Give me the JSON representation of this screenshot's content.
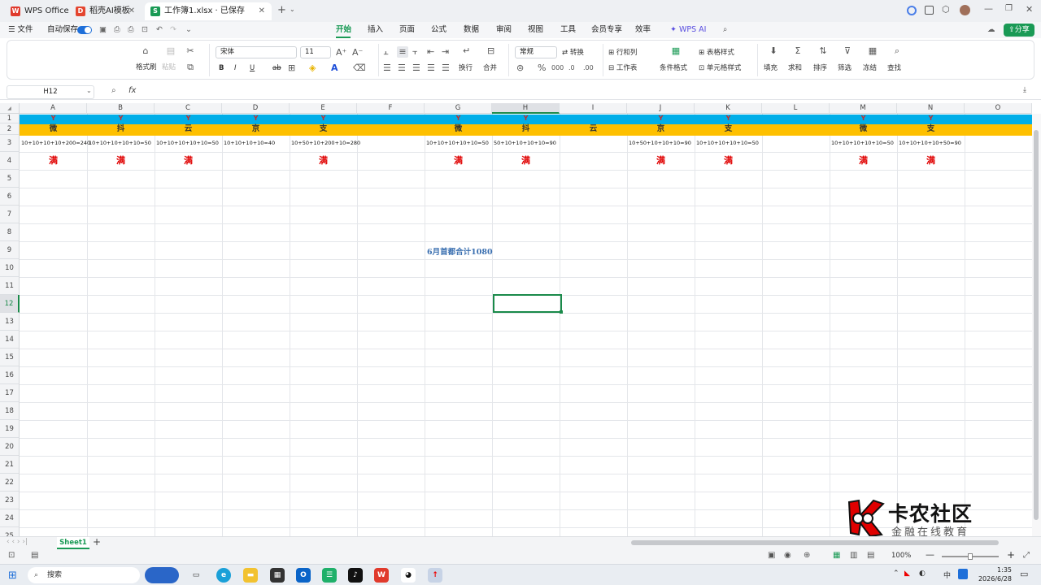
{
  "tabs": [
    {
      "label": "WPS Office",
      "icon": "W"
    },
    {
      "label": "稻壳AI模板",
      "icon": "D"
    },
    {
      "label": "工作簿1.xlsx · 已保存",
      "icon": "S"
    }
  ],
  "menu": {
    "file": "文件",
    "autosave": "自动保存",
    "items": [
      "开始",
      "插入",
      "页面",
      "公式",
      "数据",
      "审阅",
      "视图",
      "工具",
      "会员专享",
      "效率",
      "WPS AI"
    ],
    "share": "分享"
  },
  "ribbon": {
    "format_painter": "格式刷",
    "paste": "粘贴",
    "font": "宋体",
    "size": "11",
    "bold": "B",
    "italic": "I",
    "underline": "U",
    "strike": "ab",
    "wrap": "换行",
    "merge": "合并",
    "numformat": "常规",
    "convert": "转换",
    "rowcol": "行和列",
    "worksheet": "工作表",
    "cond": "条件格式",
    "tablestyle": "表格样式",
    "cellstyle": "单元格样式",
    "fill": "填充",
    "sum": "求和",
    "sort": "排序",
    "filter": "筛选",
    "freeze": "冻结",
    "find": "查找"
  },
  "formula": {
    "cellref": "H12",
    "fx": "fx",
    "value": ""
  },
  "columns": [
    "A",
    "B",
    "C",
    "D",
    "E",
    "F",
    "G",
    "H",
    "I",
    "J",
    "K",
    "L",
    "M",
    "N",
    "O"
  ],
  "rows": [
    "1",
    "2",
    "3",
    "4",
    "5",
    "6",
    "7",
    "8",
    "9",
    "10",
    "11",
    "12",
    "13",
    "14",
    "15",
    "16",
    "17",
    "18",
    "19",
    "20",
    "21",
    "22",
    "23",
    "24",
    "25"
  ],
  "row1": {
    "A": "Y",
    "B": "Y",
    "C": "Y",
    "D": "Y",
    "E": "Y",
    "G": "Y",
    "H": "Y",
    "I": "",
    "J": "Y",
    "K": "Y",
    "M": "Y",
    "N": "Y"
  },
  "row2": {
    "A": "微",
    "B": "抖",
    "C": "云",
    "D": "京",
    "E": "支",
    "G": "微",
    "H": "抖",
    "I": "云",
    "J": "京",
    "K": "支",
    "M": "微",
    "N": "支"
  },
  "row3": {
    "A": "10+10+10+10+200=240",
    "B": "10+10+10+10+10=50",
    "C": "10+10+10+10+10=50",
    "D": "10+10+10+10=40",
    "E": "10+50+10+200+10=280",
    "G": "10+10+10+10+10=50",
    "H": "50+10+10+10+10=90",
    "J": "10+50+10+10+10=90",
    "K": "10+10+10+10+10=50",
    "M": "10+10+10+10+10=50",
    "N": "10+10+10+10+50=90"
  },
  "row4": {
    "A": "满",
    "B": "满",
    "C": "满",
    "E": "满",
    "G": "满",
    "H": "满",
    "J": "满",
    "K": "满",
    "M": "满",
    "N": "满"
  },
  "note": "6月首都合计1080",
  "sheet": {
    "name": "Sheet1",
    "add": "+"
  },
  "status": {
    "zoom": "100%"
  },
  "watermark": {
    "title": "卡农社区",
    "subtitle": "金融在线教育"
  },
  "taskbar": {
    "search": "搜索",
    "time": "1:35",
    "date": "2026/6/28",
    "ime": "中"
  },
  "colors": {
    "row1": "#00aee8",
    "row2": "#fec000",
    "accent": "#1a9a55",
    "red": "#e00000"
  }
}
